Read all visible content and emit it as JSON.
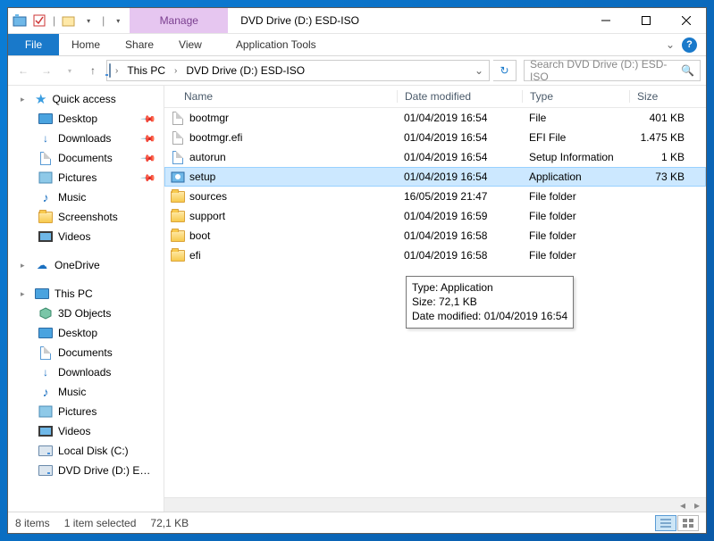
{
  "title": "DVD Drive (D:) ESD-ISO",
  "manage_tab": "Manage",
  "ribbon": {
    "file": "File",
    "home": "Home",
    "share": "Share",
    "view": "View",
    "app_tools": "Application Tools"
  },
  "breadcrumb": {
    "pc": "This PC",
    "drive": "DVD Drive (D:) ESD-ISO"
  },
  "search_placeholder": "Search DVD Drive (D:) ESD-ISO",
  "sidebar": {
    "quick": {
      "label": "Quick access",
      "items": [
        {
          "label": "Desktop",
          "icon": "monitor",
          "pinned": true
        },
        {
          "label": "Downloads",
          "icon": "down",
          "pinned": true
        },
        {
          "label": "Documents",
          "icon": "doc",
          "pinned": true
        },
        {
          "label": "Pictures",
          "icon": "pic",
          "pinned": true
        },
        {
          "label": "Music",
          "icon": "music",
          "pinned": false
        },
        {
          "label": "Screenshots",
          "icon": "folder",
          "pinned": false
        },
        {
          "label": "Videos",
          "icon": "video",
          "pinned": false
        }
      ]
    },
    "onedrive": "OneDrive",
    "thispc": {
      "label": "This PC",
      "items": [
        {
          "label": "3D Objects",
          "icon": "cube"
        },
        {
          "label": "Desktop",
          "icon": "monitor"
        },
        {
          "label": "Documents",
          "icon": "doc"
        },
        {
          "label": "Downloads",
          "icon": "down"
        },
        {
          "label": "Music",
          "icon": "music"
        },
        {
          "label": "Pictures",
          "icon": "pic"
        },
        {
          "label": "Videos",
          "icon": "video"
        },
        {
          "label": "Local Disk (C:)",
          "icon": "drive"
        },
        {
          "label": "DVD Drive (D:) ESD-ISO",
          "icon": "dvd"
        }
      ]
    }
  },
  "columns": {
    "name": "Name",
    "date": "Date modified",
    "type": "Type",
    "size": "Size"
  },
  "rows": [
    {
      "name": "bootmgr",
      "date": "01/04/2019 16:54",
      "type": "File",
      "size": "401 KB",
      "icon": "file"
    },
    {
      "name": "bootmgr.efi",
      "date": "01/04/2019 16:54",
      "type": "EFI File",
      "size": "1.475 KB",
      "icon": "file"
    },
    {
      "name": "autorun",
      "date": "01/04/2019 16:54",
      "type": "Setup Information",
      "size": "1 KB",
      "icon": "inf"
    },
    {
      "name": "setup",
      "date": "01/04/2019 16:54",
      "type": "Application",
      "size": "73 KB",
      "icon": "app",
      "selected": true
    },
    {
      "name": "sources",
      "date": "16/05/2019 21:47",
      "type": "File folder",
      "size": "",
      "icon": "folder"
    },
    {
      "name": "support",
      "date": "01/04/2019 16:59",
      "type": "File folder",
      "size": "",
      "icon": "folder"
    },
    {
      "name": "boot",
      "date": "01/04/2019 16:58",
      "type": "File folder",
      "size": "",
      "icon": "folder"
    },
    {
      "name": "efi",
      "date": "01/04/2019 16:58",
      "type": "File folder",
      "size": "",
      "icon": "folder"
    }
  ],
  "tooltip": {
    "l1": "Type: Application",
    "l2": "Size: 72,1 KB",
    "l3": "Date modified: 01/04/2019 16:54"
  },
  "status": {
    "count": "8 items",
    "sel": "1 item selected",
    "size": "72,1 KB"
  }
}
